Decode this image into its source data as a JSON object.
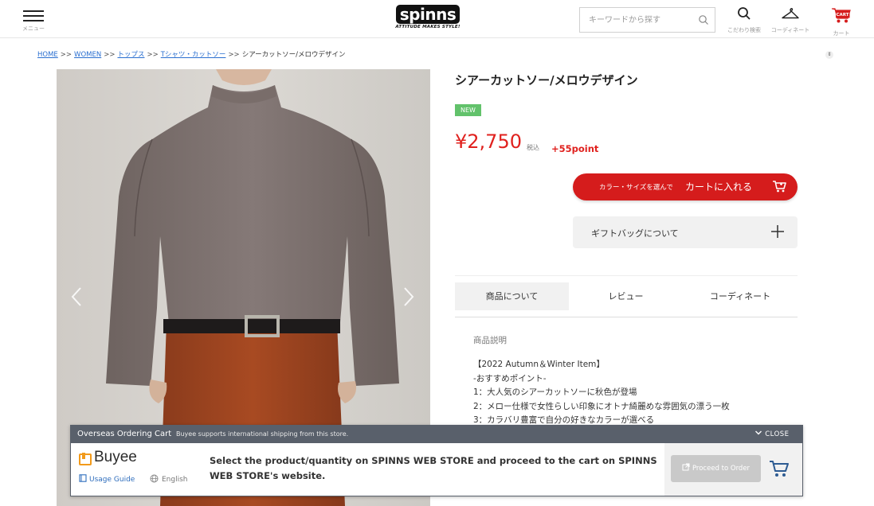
{
  "header": {
    "menu_label": "メニュー",
    "logo_word": "spinns",
    "logo_tagline": "ATTITUDE MAKES STYLE!",
    "search_placeholder": "キーワードから探す",
    "search_label": "こだわり検索",
    "coordinate_label": "コーディネート",
    "cart_label": "カート",
    "cart_icon_text": "CART"
  },
  "breadcrumb": {
    "items": [
      "HOME",
      "WOMEN",
      "トップス",
      "Tシャツ・カットソー"
    ],
    "current": "シアーカットソー/メロウデザイン",
    "separator": ">>"
  },
  "product": {
    "title": "シアーカットソー/メロウデザイン",
    "badge": "NEW",
    "price": "¥2,750",
    "tax_label": "税込",
    "points": "+55point",
    "cart_button_small": "カラー・サイズを選んで",
    "cart_button_main": "カートに入れる",
    "gift_label": "ギフトバッグについて"
  },
  "tabs": [
    "商品について",
    "レビュー",
    "コーディネート"
  ],
  "description": {
    "heading": "商品説明",
    "lines": [
      "【2022 Autumn＆Winter Item】",
      "-おすすめポイント-",
      "1：大人気のシアーカットソーに秋色が登場",
      "2：メロー仕様で女性らしい印象にオトナ綺麗めな雰囲気の漂う一枚",
      "3：カラバリ豊富で自分の好きなカラーが選べる"
    ]
  },
  "buyee": {
    "bar_title": "Overseas Ordering Cart",
    "bar_subtitle": "Buyee supports international shipping from this store.",
    "close_label": "CLOSE",
    "logo_text": "Buyee",
    "usage_label": "Usage Guide",
    "language_label": "English",
    "message": "Select the product/quantity on SPINNS WEB STORE and proceed to the cart on SPINNS WEB STORE's website.",
    "proceed_label": "Proceed to Order"
  },
  "colors": {
    "accent_red": "#d51c1c",
    "price_red": "#e0211e",
    "new_badge_green": "#62c26b",
    "buyee_bar": "#59606b",
    "buyee_orange": "#f29a1b",
    "link_blue": "#2a6fd0"
  },
  "icons": {
    "menu": "hamburger-icon",
    "search": "search-icon",
    "coordinate": "hanger-icon",
    "cart": "cart-icon",
    "gift": "plus-icon",
    "close": "chevron-down-icon",
    "proceed": "external-link-icon",
    "language": "globe-icon",
    "usage": "book-icon"
  }
}
